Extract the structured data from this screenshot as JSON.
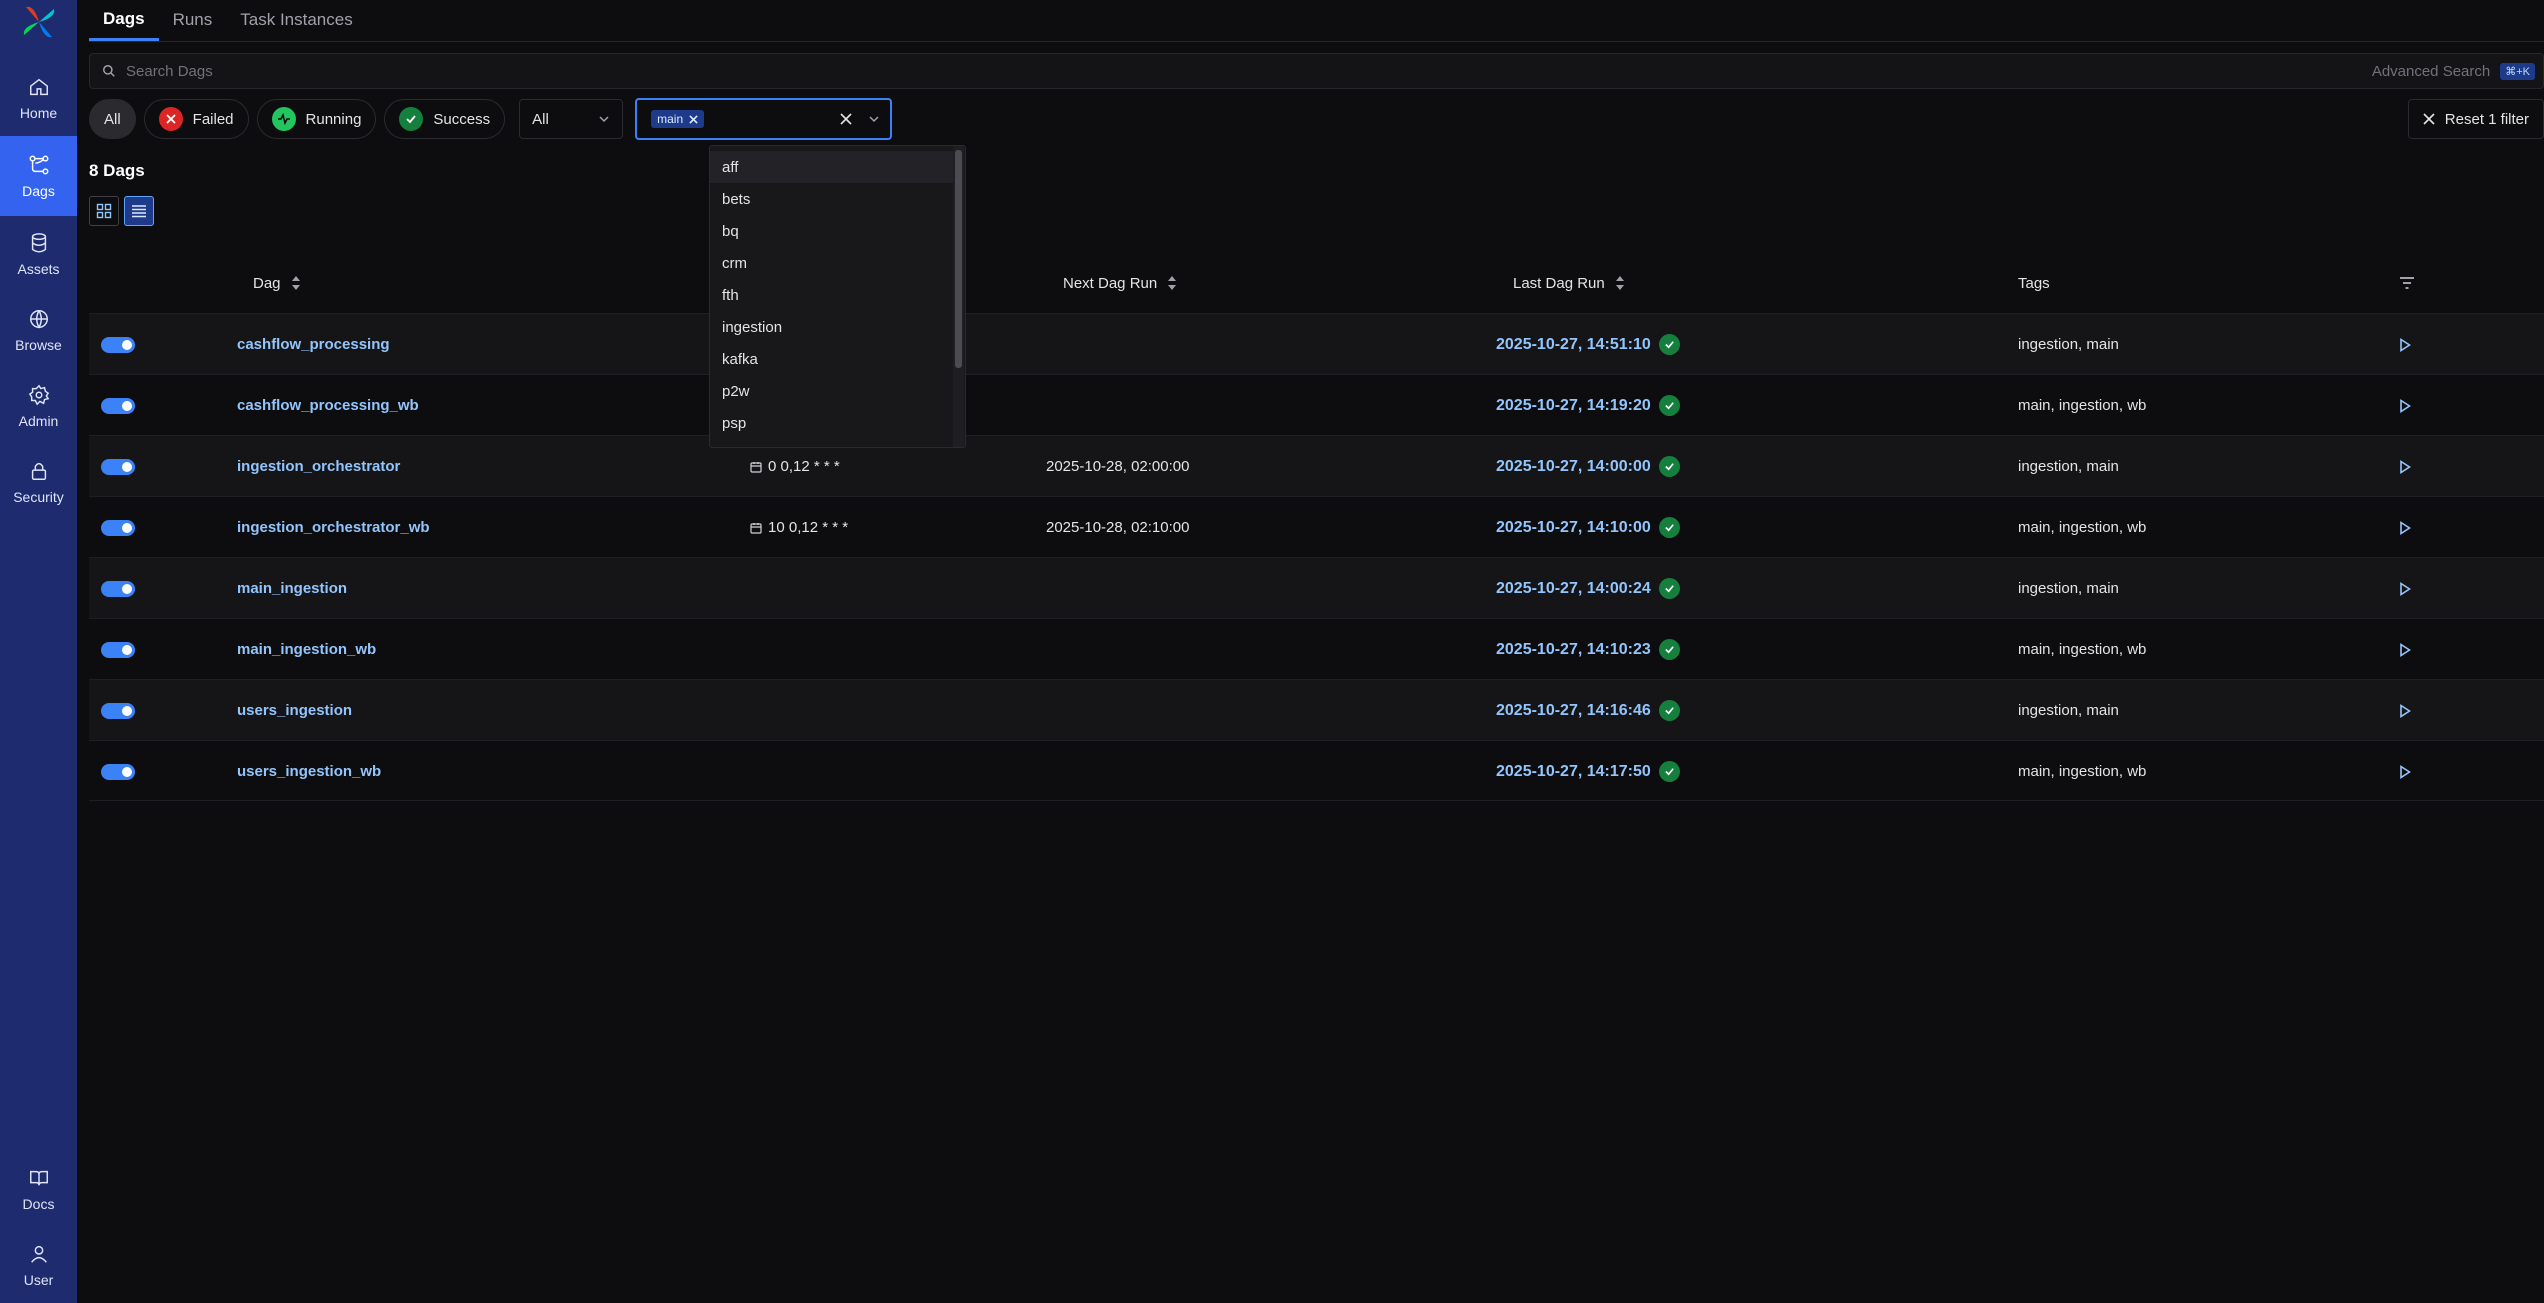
{
  "sidebar": {
    "items": [
      {
        "label": "Home",
        "icon": "home-icon"
      },
      {
        "label": "Dags",
        "icon": "dags-icon"
      },
      {
        "label": "Assets",
        "icon": "database-icon"
      },
      {
        "label": "Browse",
        "icon": "globe-icon"
      },
      {
        "label": "Admin",
        "icon": "gear-icon"
      },
      {
        "label": "Security",
        "icon": "lock-icon"
      }
    ],
    "bottom": [
      {
        "label": "Docs",
        "icon": "book-icon"
      },
      {
        "label": "User",
        "icon": "user-icon"
      }
    ]
  },
  "tabs": [
    "Dags",
    "Runs",
    "Task Instances"
  ],
  "search": {
    "placeholder": "Search Dags",
    "advanced": "Advanced Search",
    "shortcut": "⌘+K"
  },
  "filters": {
    "all": "All",
    "failed": "Failed",
    "running": "Running",
    "success": "Success",
    "select_value": "All",
    "tag_selected": "main",
    "reset": "Reset 1 filter"
  },
  "dag_count": "8 Dags",
  "table": {
    "headers": {
      "dag": "Dag",
      "next_run": "Next Dag Run",
      "last_run": "Last Dag Run",
      "tags": "Tags"
    },
    "rows": [
      {
        "name": "cashflow_processing",
        "schedule": "",
        "next_run": "",
        "last_run": "2025-10-27, 14:51:10",
        "tags": "ingestion, main"
      },
      {
        "name": "cashflow_processing_wb",
        "schedule": "",
        "next_run": "",
        "last_run": "2025-10-27, 14:19:20",
        "tags": "main, ingestion, wb"
      },
      {
        "name": "ingestion_orchestrator",
        "schedule": "0 0,12 * * *",
        "next_run": "2025-10-28, 02:00:00",
        "last_run": "2025-10-27, 14:00:00",
        "tags": "ingestion, main"
      },
      {
        "name": "ingestion_orchestrator_wb",
        "schedule": "10 0,12 * * *",
        "next_run": "2025-10-28, 02:10:00",
        "last_run": "2025-10-27, 14:10:00",
        "tags": "main, ingestion, wb"
      },
      {
        "name": "main_ingestion",
        "schedule": "",
        "next_run": "",
        "last_run": "2025-10-27, 14:00:24",
        "tags": "ingestion, main"
      },
      {
        "name": "main_ingestion_wb",
        "schedule": "",
        "next_run": "",
        "last_run": "2025-10-27, 14:10:23",
        "tags": "main, ingestion, wb"
      },
      {
        "name": "users_ingestion",
        "schedule": "",
        "next_run": "",
        "last_run": "2025-10-27, 14:16:46",
        "tags": "ingestion, main"
      },
      {
        "name": "users_ingestion_wb",
        "schedule": "",
        "next_run": "",
        "last_run": "2025-10-27, 14:17:50",
        "tags": "main, ingestion, wb"
      }
    ]
  },
  "tag_dropdown": {
    "options": [
      "aff",
      "bets",
      "bq",
      "crm",
      "fth",
      "ingestion",
      "kafka",
      "p2w",
      "psp"
    ]
  }
}
